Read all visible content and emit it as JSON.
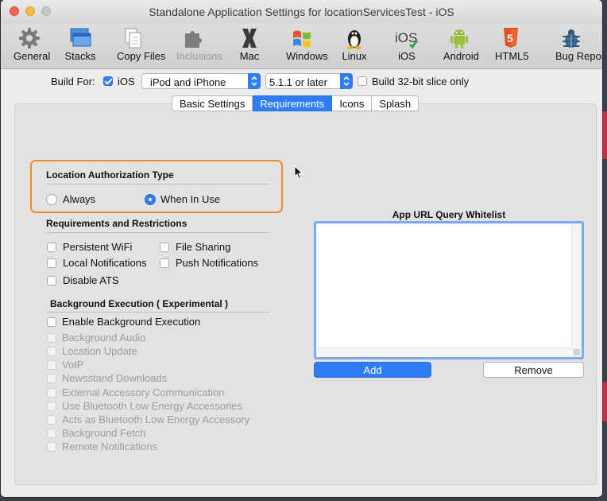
{
  "window": {
    "title": "Standalone Application Settings for locationServicesTest - iOS"
  },
  "toolbar": [
    {
      "name": "general",
      "label": "General",
      "icon": "gear-icon"
    },
    {
      "name": "stacks",
      "label": "Stacks",
      "icon": "stacks-icon"
    },
    {
      "name": "copy-files",
      "label": "Copy Files",
      "icon": "copy-files-icon"
    },
    {
      "name": "inclusions",
      "label": "Inclusions",
      "icon": "puzzle-icon",
      "disabled": true
    },
    {
      "name": "mac",
      "label": "Mac",
      "icon": "mac-x-icon"
    },
    {
      "name": "windows",
      "label": "Windows",
      "icon": "windows-logo-icon"
    },
    {
      "name": "linux",
      "label": "Linux",
      "icon": "linux-penguin-icon"
    },
    {
      "name": "ios",
      "label": "iOS",
      "icon": "ios-icon"
    },
    {
      "name": "android",
      "label": "Android",
      "icon": "android-robot-icon"
    },
    {
      "name": "html5",
      "label": "HTML5",
      "icon": "html5-shield-icon"
    },
    {
      "name": "bug-reports",
      "label": "Bug Reports",
      "icon": "bug-icon"
    }
  ],
  "build": {
    "label": "Build For:",
    "ios_label": "iOS",
    "ios_checked": true,
    "device": "iPod and iPhone",
    "version": "5.1.1 or later",
    "slice_label": "Build 32-bit slice only",
    "slice_checked": false
  },
  "tabs": [
    {
      "label": "Basic Settings",
      "active": false
    },
    {
      "label": "Requirements",
      "active": true
    },
    {
      "label": "Icons",
      "active": false
    },
    {
      "label": "Splash",
      "active": false
    }
  ],
  "location": {
    "title": "Location Authorization Type",
    "always": "Always",
    "when_in_use": "When In Use",
    "selected": "When In Use"
  },
  "requirements": {
    "title": "Requirements and Restrictions",
    "persistent_wifi": "Persistent WiFi",
    "file_sharing": "File Sharing",
    "local_notifications": "Local Notifications",
    "push_notifications": "Push Notifications",
    "disable_ats": "Disable ATS"
  },
  "background": {
    "title": "Background Execution ( Experimental )",
    "enable": "Enable Background Execution",
    "options": [
      "Background Audio",
      "Location Update",
      "VoIP",
      "Newsstand Downloads",
      "External Accessory Communication",
      "Use Bluetooth Low Energy Accessories",
      "Acts as Bluetooth Low Energy Accessory",
      "Background Fetch",
      "Remote Notifications"
    ]
  },
  "whitelist": {
    "title": "App URL Query Whitelist",
    "add": "Add",
    "remove": "Remove"
  },
  "colors": {
    "accent": "#2f7df4",
    "highlight_border": "#ee8a2a"
  }
}
